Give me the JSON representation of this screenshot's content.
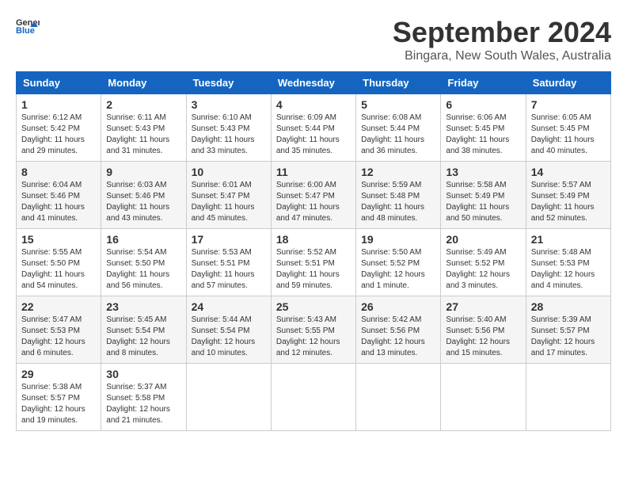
{
  "header": {
    "logo_general": "General",
    "logo_blue": "Blue",
    "month_title": "September 2024",
    "location": "Bingara, New South Wales, Australia"
  },
  "weekdays": [
    "Sunday",
    "Monday",
    "Tuesday",
    "Wednesday",
    "Thursday",
    "Friday",
    "Saturday"
  ],
  "weeks": [
    [
      {
        "day": "1",
        "sunrise": "6:12 AM",
        "sunset": "5:42 PM",
        "daylight": "11 hours and 29 minutes."
      },
      {
        "day": "2",
        "sunrise": "6:11 AM",
        "sunset": "5:43 PM",
        "daylight": "11 hours and 31 minutes."
      },
      {
        "day": "3",
        "sunrise": "6:10 AM",
        "sunset": "5:43 PM",
        "daylight": "11 hours and 33 minutes."
      },
      {
        "day": "4",
        "sunrise": "6:09 AM",
        "sunset": "5:44 PM",
        "daylight": "11 hours and 35 minutes."
      },
      {
        "day": "5",
        "sunrise": "6:08 AM",
        "sunset": "5:44 PM",
        "daylight": "11 hours and 36 minutes."
      },
      {
        "day": "6",
        "sunrise": "6:06 AM",
        "sunset": "5:45 PM",
        "daylight": "11 hours and 38 minutes."
      },
      {
        "day": "7",
        "sunrise": "6:05 AM",
        "sunset": "5:45 PM",
        "daylight": "11 hours and 40 minutes."
      }
    ],
    [
      {
        "day": "8",
        "sunrise": "6:04 AM",
        "sunset": "5:46 PM",
        "daylight": "11 hours and 41 minutes."
      },
      {
        "day": "9",
        "sunrise": "6:03 AM",
        "sunset": "5:46 PM",
        "daylight": "11 hours and 43 minutes."
      },
      {
        "day": "10",
        "sunrise": "6:01 AM",
        "sunset": "5:47 PM",
        "daylight": "11 hours and 45 minutes."
      },
      {
        "day": "11",
        "sunrise": "6:00 AM",
        "sunset": "5:47 PM",
        "daylight": "11 hours and 47 minutes."
      },
      {
        "day": "12",
        "sunrise": "5:59 AM",
        "sunset": "5:48 PM",
        "daylight": "11 hours and 48 minutes."
      },
      {
        "day": "13",
        "sunrise": "5:58 AM",
        "sunset": "5:49 PM",
        "daylight": "11 hours and 50 minutes."
      },
      {
        "day": "14",
        "sunrise": "5:57 AM",
        "sunset": "5:49 PM",
        "daylight": "11 hours and 52 minutes."
      }
    ],
    [
      {
        "day": "15",
        "sunrise": "5:55 AM",
        "sunset": "5:50 PM",
        "daylight": "11 hours and 54 minutes."
      },
      {
        "day": "16",
        "sunrise": "5:54 AM",
        "sunset": "5:50 PM",
        "daylight": "11 hours and 56 minutes."
      },
      {
        "day": "17",
        "sunrise": "5:53 AM",
        "sunset": "5:51 PM",
        "daylight": "11 hours and 57 minutes."
      },
      {
        "day": "18",
        "sunrise": "5:52 AM",
        "sunset": "5:51 PM",
        "daylight": "11 hours and 59 minutes."
      },
      {
        "day": "19",
        "sunrise": "5:50 AM",
        "sunset": "5:52 PM",
        "daylight": "12 hours and 1 minute."
      },
      {
        "day": "20",
        "sunrise": "5:49 AM",
        "sunset": "5:52 PM",
        "daylight": "12 hours and 3 minutes."
      },
      {
        "day": "21",
        "sunrise": "5:48 AM",
        "sunset": "5:53 PM",
        "daylight": "12 hours and 4 minutes."
      }
    ],
    [
      {
        "day": "22",
        "sunrise": "5:47 AM",
        "sunset": "5:53 PM",
        "daylight": "12 hours and 6 minutes."
      },
      {
        "day": "23",
        "sunrise": "5:45 AM",
        "sunset": "5:54 PM",
        "daylight": "12 hours and 8 minutes."
      },
      {
        "day": "24",
        "sunrise": "5:44 AM",
        "sunset": "5:54 PM",
        "daylight": "12 hours and 10 minutes."
      },
      {
        "day": "25",
        "sunrise": "5:43 AM",
        "sunset": "5:55 PM",
        "daylight": "12 hours and 12 minutes."
      },
      {
        "day": "26",
        "sunrise": "5:42 AM",
        "sunset": "5:56 PM",
        "daylight": "12 hours and 13 minutes."
      },
      {
        "day": "27",
        "sunrise": "5:40 AM",
        "sunset": "5:56 PM",
        "daylight": "12 hours and 15 minutes."
      },
      {
        "day": "28",
        "sunrise": "5:39 AM",
        "sunset": "5:57 PM",
        "daylight": "12 hours and 17 minutes."
      }
    ],
    [
      {
        "day": "29",
        "sunrise": "5:38 AM",
        "sunset": "5:57 PM",
        "daylight": "12 hours and 19 minutes."
      },
      {
        "day": "30",
        "sunrise": "5:37 AM",
        "sunset": "5:58 PM",
        "daylight": "12 hours and 21 minutes."
      },
      null,
      null,
      null,
      null,
      null
    ]
  ]
}
